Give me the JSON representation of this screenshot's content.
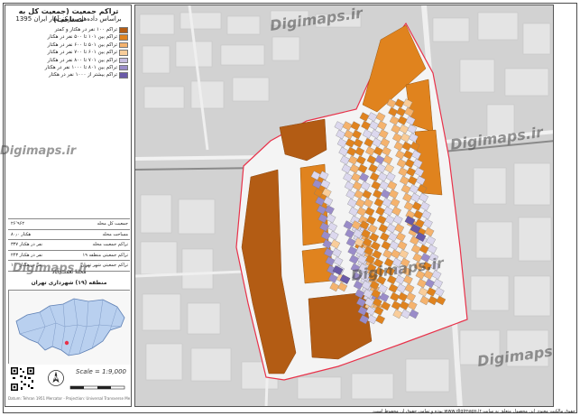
{
  "title": {
    "line1": "تراکم جمعیت (جمعیت کل به مساحت)",
    "line2": "براساس داده‌های مرکز آمار ایران 1395"
  },
  "legend": {
    "items": [
      {
        "label": "تراکم ۱۰۰ نفر در هکتار و کمتر",
        "color": "#b35c14"
      },
      {
        "label": "تراکم بین ۱۰۱ تا ۵۰۰ نفر در هکتار",
        "color": "#e0831e"
      },
      {
        "label": "تراکم بین ۵۰۱ تا ۶۰۰ نفر در هکتار",
        "color": "#f5b36e"
      },
      {
        "label": "تراکم بین ۶۰۱ تا ۷۰۰ نفر در هکتار",
        "color": "#f9cd9a"
      },
      {
        "label": "تراکم بین ۷۰۱ تا ۸۰۰ نفر در هکتار",
        "color": "#c6bce0"
      },
      {
        "label": "تراکم بین ۸۰۱ تا ۱۰۰۰ نفر در هکتار",
        "color": "#9a8cc9"
      },
      {
        "label": "تراکم بیشتر از ۱۰۰۰ نفر در هکتار",
        "color": "#6a5aa8"
      }
    ]
  },
  "stats": [
    {
      "key": "جمعیت کل محله",
      "value": "۲۶٬۹۶۲"
    },
    {
      "key": "مساحت محله",
      "value": "۸۰٫۰ هکتار"
    },
    {
      "key": "تراکم جمعیت محله",
      "value": "۳۳۷ نفر در هکتار"
    },
    {
      "key": "تراکم جمعیتی منطقه ۱۹",
      "value": "۲۴۳ نفر در هکتار"
    },
    {
      "key": "تراکم جمعیتی شهر تهران",
      "value": "۱۰۰ نفر در هکتار"
    }
  ],
  "region_label": "محله نعمت آباد",
  "zone_label": "منطقه (۱۹) شهرداری تهران",
  "scale_text": "Scale = 1:9,000",
  "credits_text": "Datum: Tehran 1951 Mercator - Projection: Universal Transverse Mercator",
  "watermark": "Digimaps.ir",
  "footer_text": "حقوق مالکیت معنوی این محصول متعلق به سایت www.digimaps.ir بوده و تمامی حقوق آن محفوظ است.",
  "colors": {
    "low": "#b35c14",
    "mid": "#e0831e",
    "light_orange": "#f5b36e",
    "pale_orange": "#f9cd9a",
    "pale_purple": "#dcd8ee",
    "purple": "#9a8cc9",
    "dark_purple": "#6a5aa8",
    "boundary": "#e8324a"
  }
}
